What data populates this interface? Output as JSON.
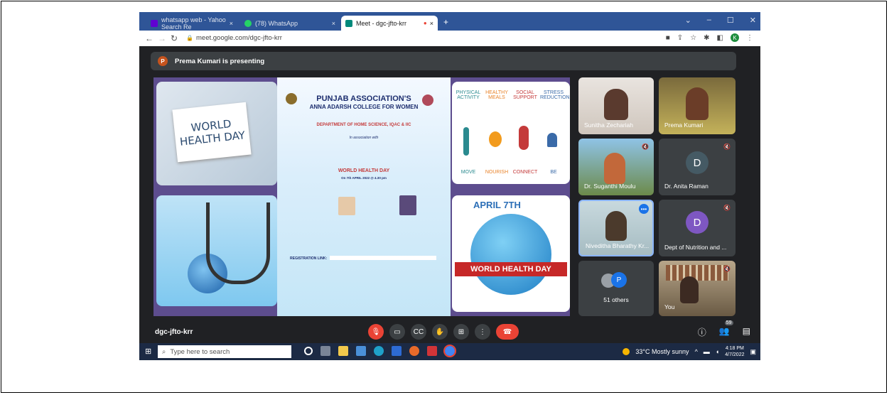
{
  "browser": {
    "tabs": [
      {
        "label": "whatsapp web - Yahoo Search Re",
        "close": "×",
        "color": "#6001d2"
      },
      {
        "label": "(78) WhatsApp",
        "close": "×",
        "color": "#25d366"
      },
      {
        "label": "Meet - dgc-jfto-krr",
        "close": "×",
        "color": "#00897b"
      }
    ],
    "new_tab": "+",
    "url": "meet.google.com/dgc-jfto-krr",
    "profile_initial": "K",
    "window_controls": [
      "⌄",
      "–",
      "☐",
      "✕"
    ]
  },
  "meet": {
    "presenter_initial": "P",
    "presenting_text": "Prema Kumari is presenting",
    "slide": {
      "left_top_text": "WORLD\nHEALTH DAY",
      "flyer_title": "PUNJAB ASSOCIATION'S",
      "flyer_college": "ANNA ADARSH COLLEGE FOR WOMEN",
      "flyer_dept": "DEPARTMENT OF HOME SCIENCE, IQAC & IIC",
      "flyer_assoc": "In association with",
      "flyer_event": "WORLD HEALTH DAY",
      "flyer_date": "On 7th APRIL 2022 @ 4.30 pm",
      "flyer_reg": "REGISTRATION LINK:",
      "right_top": [
        "PHYSICAL ACTIVITY",
        "HEALTHY MEALS",
        "SOCIAL SUPPORT",
        "STRESS REDUCTION"
      ],
      "right_top_bottom": [
        "MOVE",
        "NOURISH",
        "CONNECT",
        "BE"
      ],
      "right_bottom_title": "APRIL 7TH",
      "right_bottom_banner": "WORLD HEALTH DAY"
    },
    "participants": [
      {
        "name": "Sunitha Zechariah"
      },
      {
        "name": "Prema Kumari"
      },
      {
        "name": "Dr. Suganthi Moulu"
      },
      {
        "name": "Dr. Anita Raman",
        "initial": "D",
        "color": "#455a64"
      },
      {
        "name": "Niveditha Bharathy Kr..."
      },
      {
        "name": "Dept of Nutrition and ...",
        "initial": "D",
        "color": "#7e57c2"
      },
      {
        "name": "51 others",
        "initial": "P",
        "color": "#1a73e8"
      },
      {
        "name": "You"
      }
    ],
    "meeting_code": "dgc-jfto-krr",
    "participant_count": "59"
  },
  "taskbar": {
    "search_placeholder": "Type here to search",
    "weather": "33°C  Mostly sunny",
    "time": "4:18 PM",
    "date": "4/7/2022"
  }
}
